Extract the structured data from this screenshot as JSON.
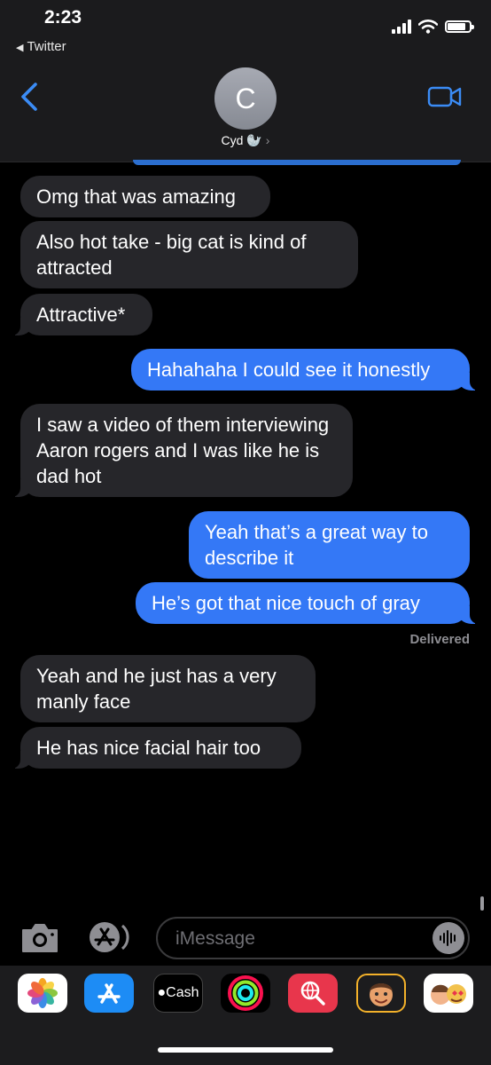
{
  "status_bar": {
    "time": "2:23",
    "back_app": "Twitter"
  },
  "header": {
    "avatar_initial": "C",
    "contact_name": "Cyd 🦭"
  },
  "messages": [
    {
      "from": "them",
      "text": "Omg that was amazing"
    },
    {
      "from": "them",
      "text": "Also hot take - big cat is kind of attracted"
    },
    {
      "from": "them",
      "text": "Attractive*"
    },
    {
      "from": "me",
      "text": "Hahahaha I could see it honestly"
    },
    {
      "from": "them",
      "text": "I saw a video of them interviewing Aaron rogers and I was like he is dad hot"
    },
    {
      "from": "me",
      "text": "Yeah that’s a great way to describe it"
    },
    {
      "from": "me",
      "text": "He’s got that nice touch of gray"
    },
    {
      "from": "them",
      "text": "Yeah and he just has a very manly face"
    },
    {
      "from": "them",
      "text": "He has nice facial hair too"
    }
  ],
  "delivery_status": "Delivered",
  "composer": {
    "placeholder": "iMessage"
  },
  "app_drawer": [
    "photos-icon",
    "app-store-icon",
    "apple-cash-icon",
    "activity-icon",
    "web-search-icon",
    "memoji-icon",
    "memoji-stickers-icon"
  ],
  "cash_label": "Cash",
  "colors": {
    "outgoing_bubble": "#3478f6",
    "incoming_bubble": "#26262a",
    "accent": "#3b8cf6",
    "background": "#000000"
  }
}
